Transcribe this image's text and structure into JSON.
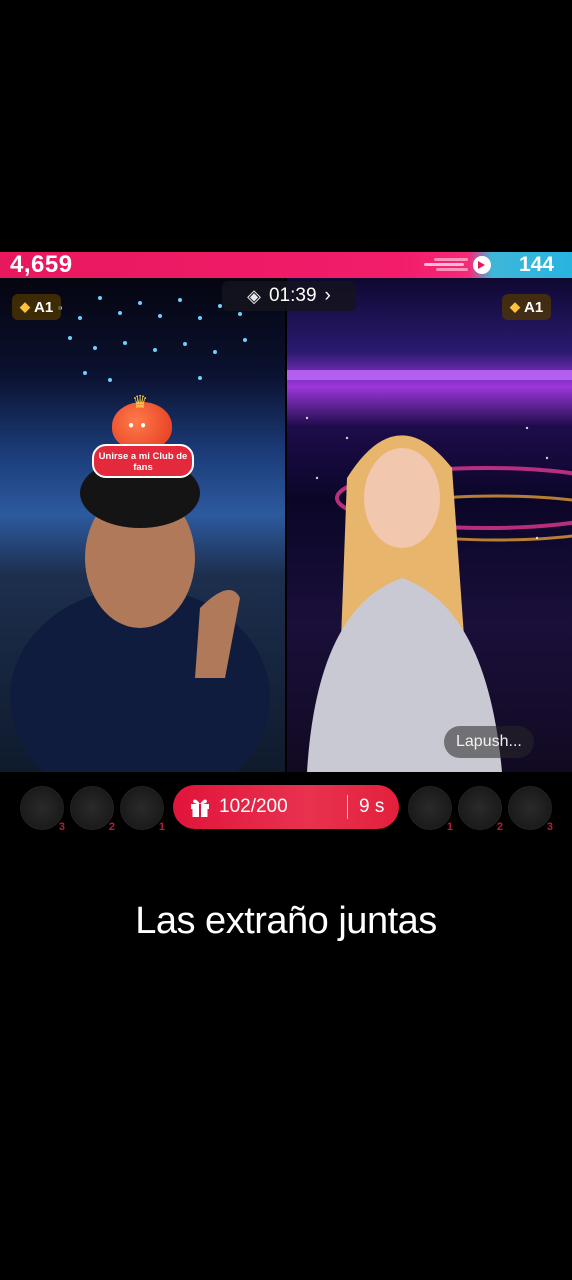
{
  "battle": {
    "left_score": "4,659",
    "right_score": "144",
    "timer": "01:39",
    "left_badge": "A1",
    "right_badge": "A1"
  },
  "fan_club": {
    "label": "Unirse a mi Club de fans"
  },
  "right_streamer": {
    "name": "Lapush..."
  },
  "gift_goal": {
    "progress": "102/200",
    "countdown": "9 s"
  },
  "left_gifters": [
    {
      "rank": "3"
    },
    {
      "rank": "2"
    },
    {
      "rank": "1"
    }
  ],
  "right_gifters": [
    {
      "rank": "1"
    },
    {
      "rank": "2"
    },
    {
      "rank": "3"
    }
  ],
  "caption": "Las extraño juntas",
  "colors": {
    "left_team": "#e8185e",
    "right_team": "#27b4e0",
    "gift_bar": "#e1143c"
  }
}
